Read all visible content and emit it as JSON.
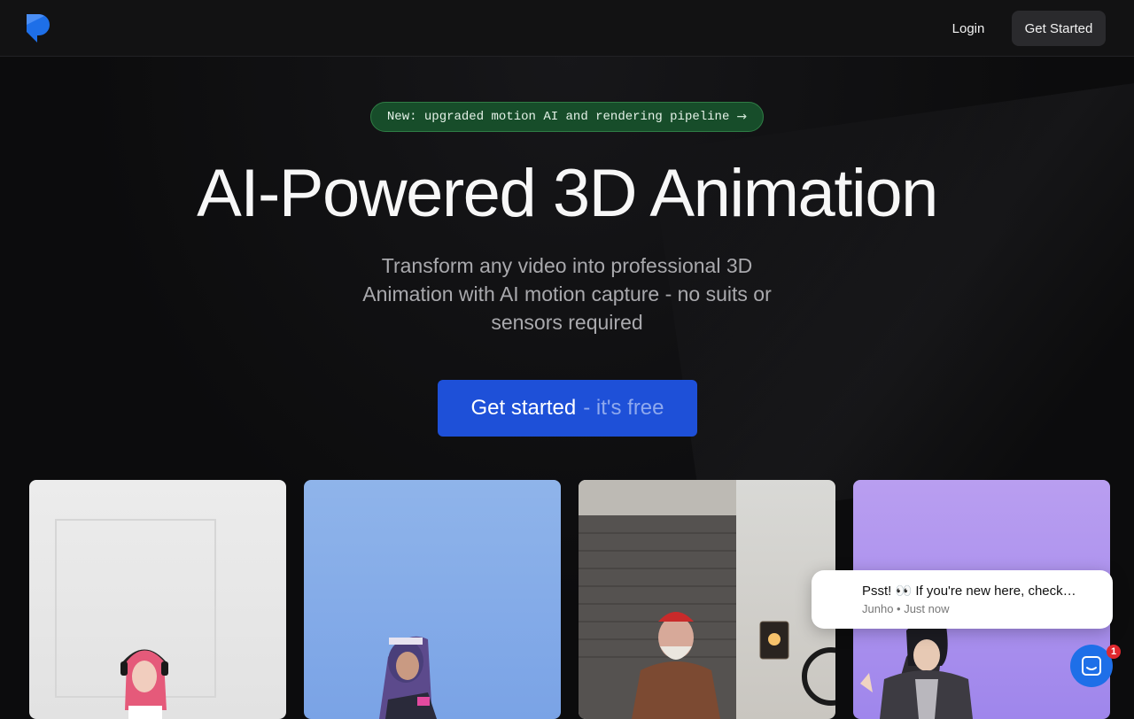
{
  "nav": {
    "login_label": "Login",
    "get_started_label": "Get Started"
  },
  "hero": {
    "announcement": "New: upgraded motion AI and rendering pipeline",
    "title": "AI-Powered 3D Animation",
    "subtitle": "Transform any video into professional 3D Animation with AI motion capture - no suits or sensors required",
    "cta_main": "Get started",
    "cta_sub": "- it's free"
  },
  "gallery": {
    "items": [
      {
        "icon": "character-woman-headphones"
      },
      {
        "icon": "character-anime-avatar"
      },
      {
        "icon": "character-old-man-hat"
      },
      {
        "icon": "character-anime-boy"
      }
    ]
  },
  "chat": {
    "message": "Psst! 👀 If you're new here, check…",
    "meta": "Junho • Just now",
    "unread_count": "1"
  },
  "colors": {
    "background": "#0c0c0d",
    "accent": "#1e50d8",
    "announcement_bg": "#174d2a",
    "chat": "#1e6fe8"
  }
}
